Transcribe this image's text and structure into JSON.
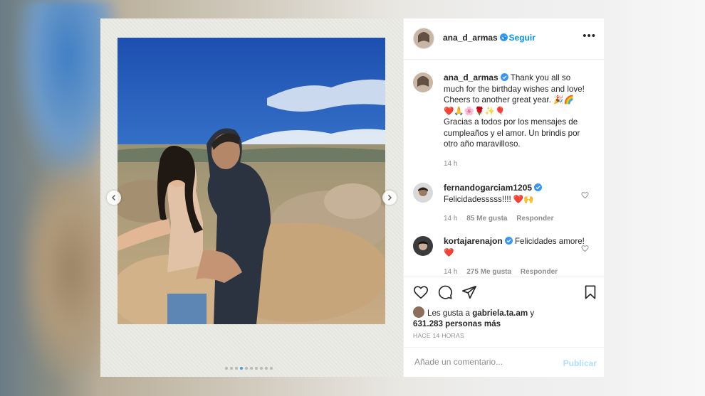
{
  "post": {
    "username": "ana_d_armas",
    "follow_label": "Seguir",
    "more_label": "•••",
    "carousel": {
      "current_index": 3,
      "total": 10
    }
  },
  "caption": {
    "username": "ana_d_armas",
    "text_en": "Thank you all so much for the birthday wishes and love! Cheers to another great year. 🎉🌈",
    "text_emojis": "❤️🙏🌸🌹✨🎈",
    "text_es": "Gracias a todos por los mensajes de cumpleaños y el amor. Un brindis por otro año maravilloso.",
    "time": "14 h"
  },
  "comments": [
    {
      "username": "fernandogarciam1205",
      "text": "Felicidadesssss!!!! ❤️🙌",
      "time": "14 h",
      "likes": "85 Me gusta",
      "reply_label": "Responder"
    },
    {
      "username": "kortajarenajon",
      "text": "Felicidades amore! ❤️",
      "time": "14 h",
      "likes": "275 Me gusta",
      "reply_label": "Responder"
    }
  ],
  "likes": {
    "prefix": "Les gusta a",
    "first_user": "gabriela.ta.am",
    "connector": "y",
    "others": "631.283 personas más"
  },
  "timestamp": "HACE 14 HORAS",
  "comment_box": {
    "placeholder": "Añade un comentario...",
    "publish_label": "Publicar"
  },
  "colors": {
    "accent": "#0095f6",
    "publish_disabled": "#b2dffc",
    "verified": "#3897f0",
    "heart": "#ed4956"
  }
}
